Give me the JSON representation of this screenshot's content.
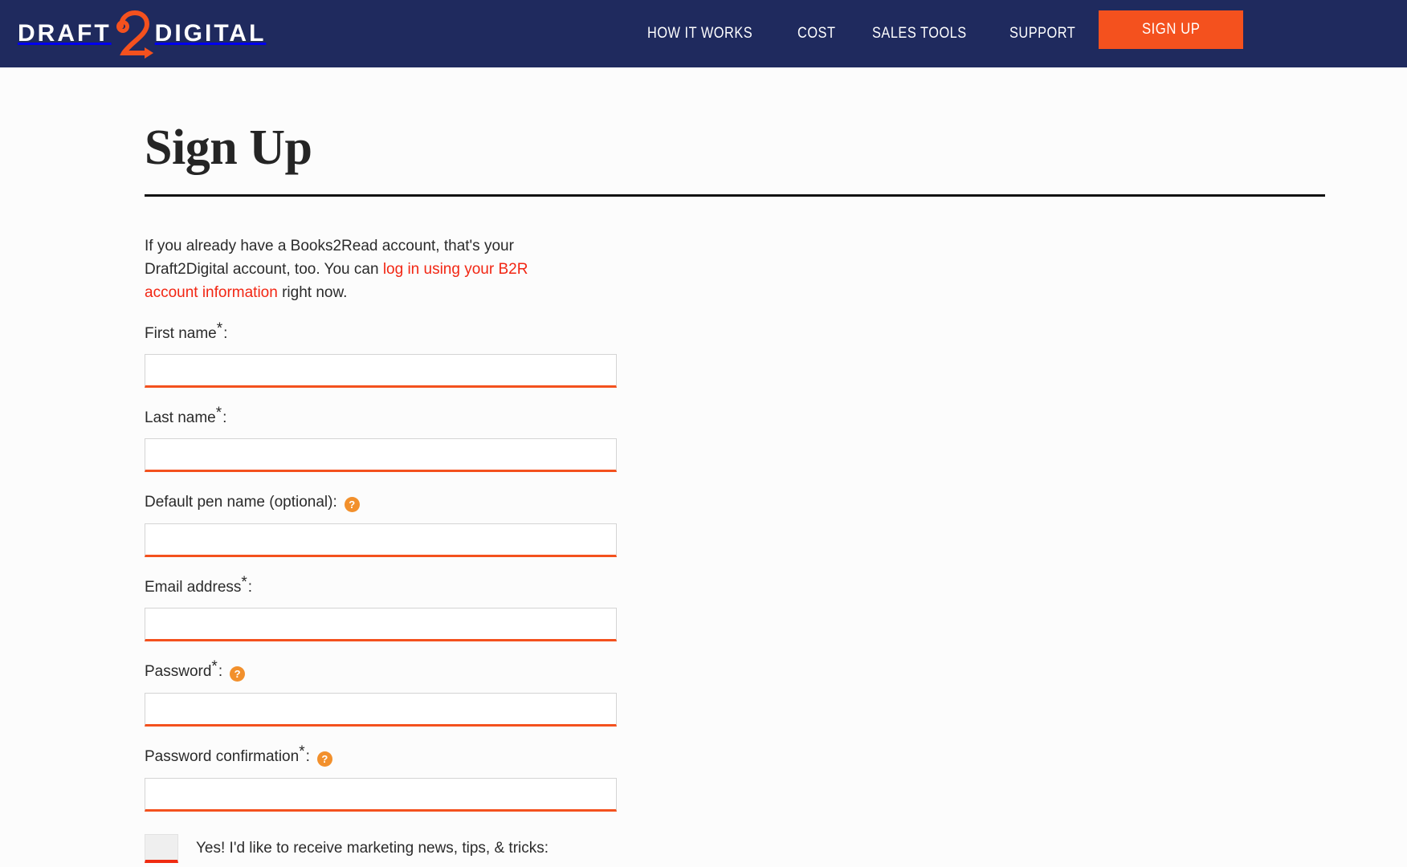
{
  "header": {
    "logo": {
      "left_text": "DRAFT",
      "mark": "2",
      "right_text": "DIGITAL"
    },
    "nav": [
      {
        "label": "HOW IT WORKS"
      },
      {
        "label": "COST"
      },
      {
        "label": "SALES TOOLS"
      },
      {
        "label": "SUPPORT"
      }
    ],
    "signup_label": "SIGN UP",
    "colors": {
      "navy": "#1f2a5e",
      "orange": "#f4511e",
      "white": "#ffffff"
    }
  },
  "main": {
    "title": "Sign Up",
    "intro": {
      "before_link": "If you already have a Books2Read account, that's your Draft2Digital account, too. You can ",
      "link_text": "log in using your B2R account information",
      "after_link": " right now.",
      "link_color": "#f22613"
    },
    "fields": [
      {
        "label": "First name",
        "required": true,
        "required_mark": "*",
        "colon": ":",
        "value": "",
        "placeholder": "",
        "help": false
      },
      {
        "label": "Last name",
        "required": true,
        "required_mark": "*",
        "colon": ":",
        "value": "",
        "placeholder": "",
        "help": false
      },
      {
        "label": "Default pen name (optional):",
        "required": false,
        "required_mark": "",
        "colon": "",
        "value": "",
        "placeholder": "",
        "help": true,
        "help_icon": "question-mark-icon"
      },
      {
        "label": "Email address",
        "required": true,
        "required_mark": "*",
        "colon": ":",
        "value": "",
        "placeholder": "",
        "help": false
      },
      {
        "label": "Password",
        "required": true,
        "required_mark": "*",
        "colon": ":",
        "value": "",
        "placeholder": "",
        "help": true,
        "help_icon": "question-mark-icon"
      },
      {
        "label": "Password confirmation",
        "required": true,
        "required_mark": "*",
        "colon": ":",
        "value": "",
        "placeholder": "",
        "help": true,
        "help_icon": "question-mark-icon"
      }
    ],
    "marketing_checkbox": {
      "label": "Yes! I'd like to receive marketing news, tips, & tricks:",
      "checked": false
    }
  }
}
